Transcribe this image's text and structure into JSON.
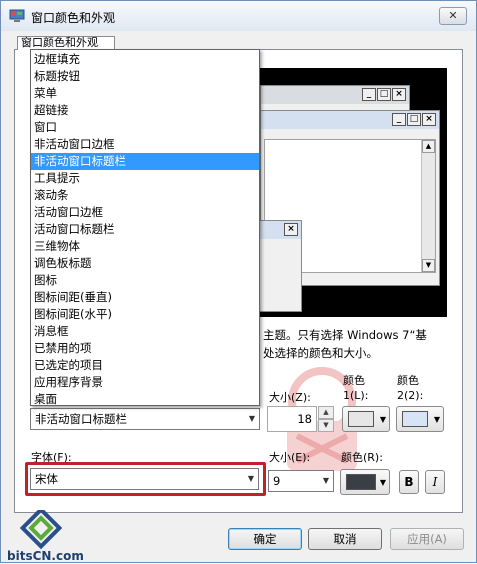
{
  "window": {
    "title": "窗口颜色和外观",
    "close_label": "✕"
  },
  "tab": {
    "label": "窗口颜色和外观"
  },
  "item_list": [
    "边框填充",
    "标题按钮",
    "菜单",
    "超链接",
    "窗口",
    "非活动窗口边框",
    "非活动窗口标题栏",
    "工具提示",
    "滚动条",
    "活动窗口边框",
    "活动窗口标题栏",
    "三维物体",
    "调色板标题",
    "图标",
    "图标间距(垂直)",
    "图标间距(水平)",
    "消息框",
    "已禁用的项",
    "已选定的项目",
    "应用程序背景",
    "桌面"
  ],
  "selected_index": 6,
  "description": {
    "line1": "主题。只有选择 Windows 7“基",
    "line2": "处选择的颜色和大小。"
  },
  "item_section": {
    "combo_value": "非活动窗口标题栏",
    "size_label": "大小(Z):",
    "size_value": "18",
    "color1_label_top": "颜色",
    "color1_label_bottom": "1(L):",
    "color2_label_top": "颜色",
    "color2_label_bottom": "2(2):",
    "color1_hex": "#e6e6e6",
    "color2_hex": "#d6e4f5"
  },
  "font_section": {
    "font_label": "字体(F):",
    "font_value": "宋体",
    "size_label": "大小(E):",
    "size_value": "9",
    "color_label": "颜色(R):",
    "color_hex": "#3a3f45",
    "bold_label": "B",
    "italic_label": "I"
  },
  "buttons": {
    "ok": "确定",
    "cancel": "取消",
    "apply": "应用(A)"
  },
  "logo": {
    "text": "bitsCN.com"
  },
  "preview": {
    "minimize": "_",
    "maximize": "□",
    "close": "×"
  },
  "colors": {
    "selection": "#3399ff",
    "highlight_frame": "#c0212b"
  }
}
